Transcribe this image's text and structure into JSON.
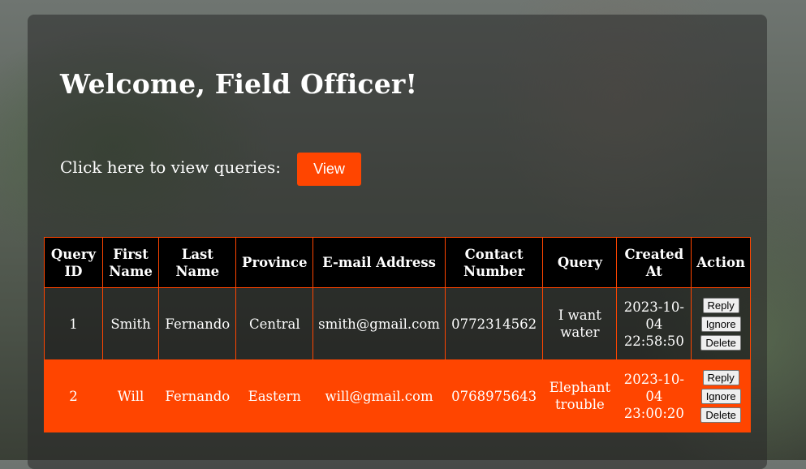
{
  "header": {
    "welcome": "Welcome, Field Officer!"
  },
  "view_section": {
    "prompt": "Click here to view queries:",
    "button_label": "View"
  },
  "table": {
    "columns": [
      "Query ID",
      "First Name",
      "Last Name",
      "Province",
      "E-mail Address",
      "Contact Number",
      "Query",
      "Created At",
      "Action"
    ],
    "rows": [
      {
        "id": "1",
        "first": "Smith",
        "last": "Fernando",
        "province": "Central",
        "email": "smith@gmail.com",
        "contact": "0772314562",
        "query": "I want water",
        "created": "2023-10-04 22:58:50"
      },
      {
        "id": "2",
        "first": "Will",
        "last": "Fernando",
        "province": "Eastern",
        "email": "will@gmail.com",
        "contact": "0768975643",
        "query": "Elephant trouble",
        "created": "2023-10-04 23:00:20"
      }
    ],
    "actions": {
      "reply": "Reply",
      "ignore": "Ignore",
      "delete": "Delete"
    }
  },
  "colors": {
    "accent": "#ff4500",
    "header_bg": "#000000"
  }
}
